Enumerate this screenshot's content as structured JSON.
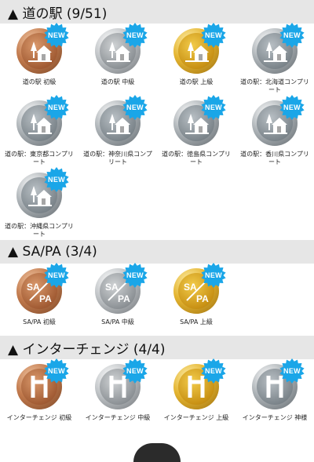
{
  "colors": {
    "new_badge": "#1aa6e8",
    "header_bg": "#e6e6e6"
  },
  "sections": [
    {
      "title": "▲ 道の駅 (9/51)",
      "items": [
        {
          "label": "道の駅 初級",
          "tier": "bronze",
          "icon": "station-icon",
          "new": "NEW"
        },
        {
          "label": "道の駅 中級",
          "tier": "silver",
          "icon": "station-icon",
          "new": "NEW"
        },
        {
          "label": "道の駅 上級",
          "tier": "gold",
          "icon": "station-icon",
          "new": "NEW"
        },
        {
          "label": "道の駅：北海道コンプリート",
          "tier": "complete",
          "icon": "station-icon",
          "new": "NEW"
        },
        {
          "label": "道の駅：東京都コンプリート",
          "tier": "complete",
          "icon": "station-icon",
          "new": "NEW"
        },
        {
          "label": "道の駅：神奈川県コンプリート",
          "tier": "complete",
          "icon": "station-icon",
          "new": "NEW"
        },
        {
          "label": "道の駅：徳島県コンプリート",
          "tier": "complete",
          "icon": "station-icon",
          "new": "NEW"
        },
        {
          "label": "道の駅：香川県コンプリート",
          "tier": "complete",
          "icon": "station-icon",
          "new": "NEW"
        },
        {
          "label": "道の駅：沖縄県コンプリート",
          "tier": "complete",
          "icon": "station-icon",
          "new": "NEW"
        }
      ]
    },
    {
      "title": "▲ SA/PA (3/4)",
      "items": [
        {
          "label": "SA/PA 初級",
          "tier": "bronze",
          "icon": "sapa-icon",
          "new": "NEW",
          "icon_text_top": "SA",
          "icon_text_bottom": "PA"
        },
        {
          "label": "SA/PA 中級",
          "tier": "silver",
          "icon": "sapa-icon",
          "new": "NEW",
          "icon_text_top": "SA",
          "icon_text_bottom": "PA"
        },
        {
          "label": "SA/PA 上級",
          "tier": "gold",
          "icon": "sapa-icon",
          "new": "NEW",
          "icon_text_top": "SA",
          "icon_text_bottom": "PA"
        }
      ]
    },
    {
      "title": "▲ インターチェンジ (4/4)",
      "items": [
        {
          "label": "インターチェンジ 初級",
          "tier": "bronze",
          "icon": "interchange-icon",
          "new": "NEW"
        },
        {
          "label": "インターチェンジ 中級",
          "tier": "silver",
          "icon": "interchange-icon",
          "new": "NEW"
        },
        {
          "label": "インターチェンジ 上級",
          "tier": "gold",
          "icon": "interchange-icon",
          "new": "NEW"
        },
        {
          "label": "インターチェンジ 神様",
          "tier": "complete",
          "icon": "interchange-icon",
          "new": "NEW"
        }
      ]
    }
  ]
}
